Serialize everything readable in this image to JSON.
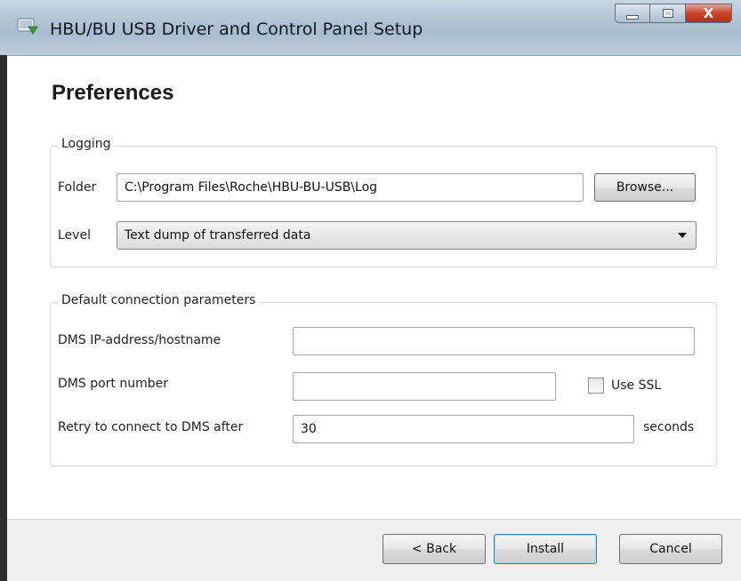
{
  "window": {
    "title": "HBU/BU USB Driver and Control Panel Setup",
    "close_glyph": "X"
  },
  "page": {
    "heading": "Preferences"
  },
  "logging": {
    "legend": "Logging",
    "folder_label": "Folder",
    "folder_value": "C:\\Program Files\\Roche\\HBU-BU-USB\\Log",
    "browse_label": "Browse...",
    "level_label": "Level",
    "level_value": "Text dump of transferred data"
  },
  "connection": {
    "legend": "Default connection parameters",
    "host_label": "DMS IP-address/hostname",
    "host_value": "",
    "port_label": "DMS port number",
    "port_value": "",
    "ssl_label": "Use SSL",
    "ssl_checked": false,
    "retry_label": "Retry to connect to DMS after",
    "retry_value": "30",
    "retry_unit": "seconds"
  },
  "footer": {
    "back_label": "< Back",
    "install_label": "Install",
    "cancel_label": "Cancel"
  }
}
